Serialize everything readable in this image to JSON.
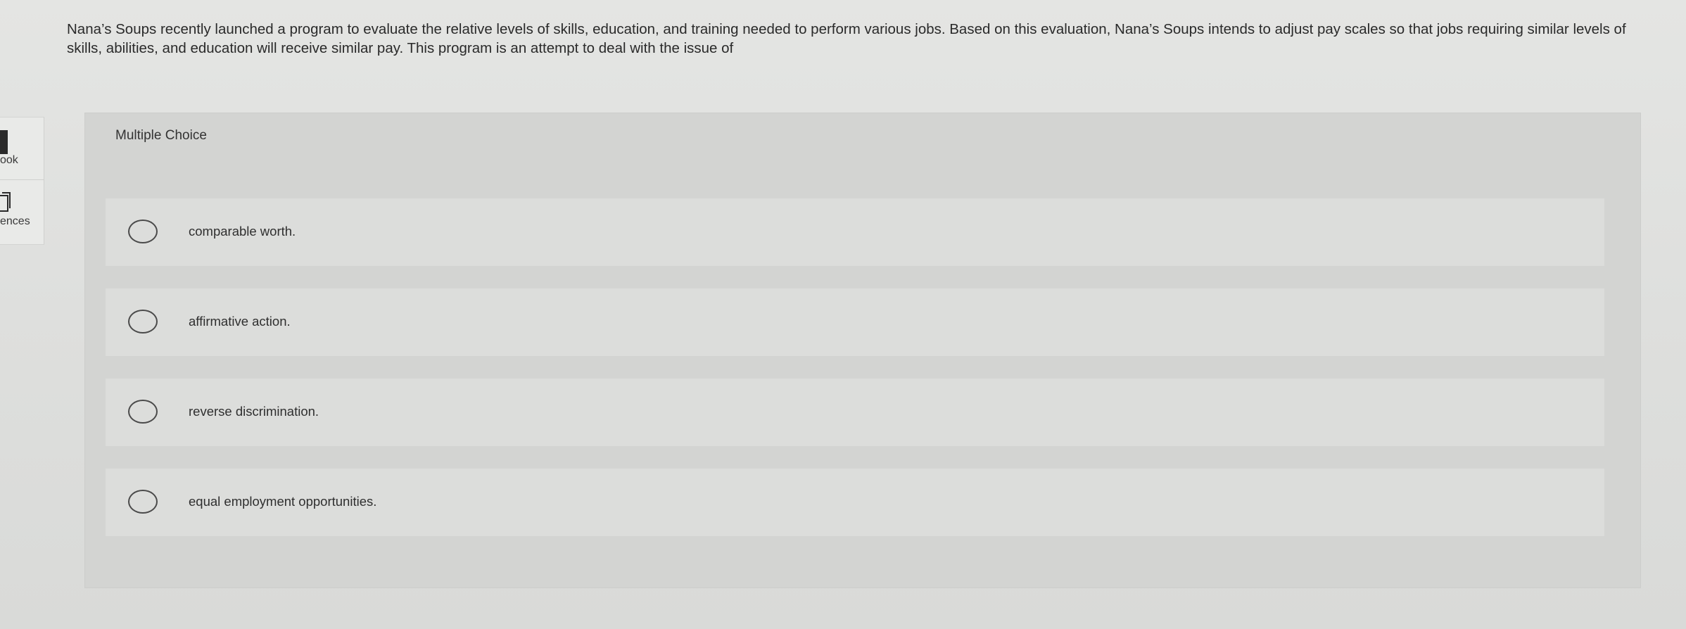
{
  "sidebar": {
    "items": [
      {
        "label": "ook",
        "icon": "ebook-icon"
      },
      {
        "label": "ences",
        "icon": "references-icon"
      }
    ]
  },
  "question": {
    "text": "Nana’s Soups recently launched a program to evaluate the relative levels of skills, education, and training needed to perform various jobs. Based on this evaluation, Nana’s Soups intends to adjust pay scales so that jobs requiring similar levels of skills, abilities, and education will receive similar pay. This program is an attempt to deal with the issue of"
  },
  "card": {
    "type_label": "Multiple Choice"
  },
  "options": [
    {
      "text": "comparable worth."
    },
    {
      "text": "affirmative action."
    },
    {
      "text": "reverse discrimination."
    },
    {
      "text": "equal employment opportunities."
    }
  ]
}
